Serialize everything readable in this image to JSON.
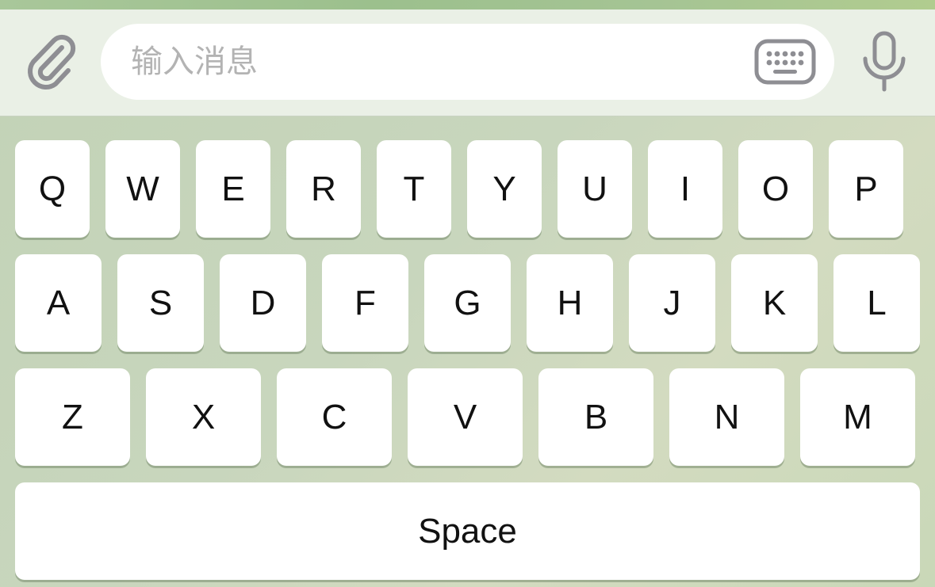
{
  "input_bar": {
    "placeholder": "输入消息",
    "value": ""
  },
  "icons": {
    "attach": "paperclip-icon",
    "keyboard": "keyboard-icon",
    "mic": "microphone-icon"
  },
  "colors": {
    "icon_gray": "#8e8e93",
    "key_background": "#ffffff",
    "input_bar_background": "#eaf0e6",
    "keyboard_background": "#c6d4ba"
  },
  "keyboard": {
    "row1": [
      "Q",
      "W",
      "E",
      "R",
      "T",
      "Y",
      "U",
      "I",
      "O",
      "P"
    ],
    "row2": [
      "A",
      "S",
      "D",
      "F",
      "G",
      "H",
      "J",
      "K",
      "L"
    ],
    "row3": [
      "Z",
      "X",
      "C",
      "V",
      "B",
      "N",
      "M"
    ],
    "space_label": "Space"
  }
}
